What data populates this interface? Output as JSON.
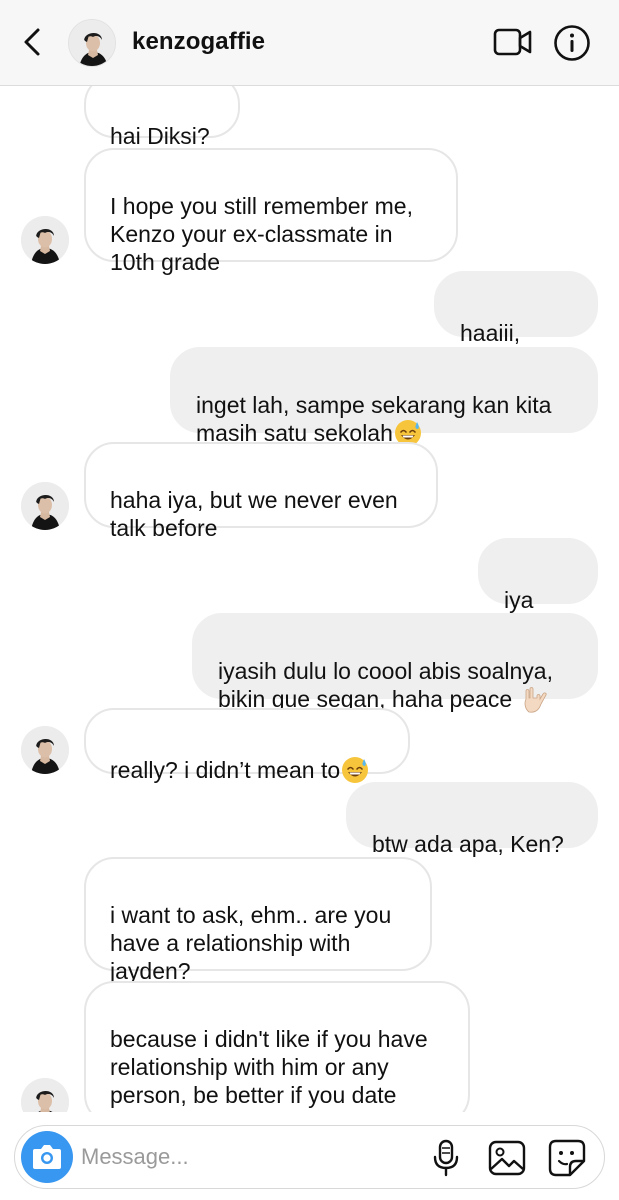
{
  "header": {
    "username": "kenzogaffie",
    "icons": {
      "back": "chevron-left-icon",
      "video": "video-call-icon",
      "info": "info-icon"
    }
  },
  "messages": [
    {
      "sender": "kenzogaffie",
      "direction": "incoming",
      "text": "hai Diksi?"
    },
    {
      "sender": "kenzogaffie",
      "direction": "incoming",
      "text": "I hope you still remember me,\nKenzo your ex-classmate in\n10th grade"
    },
    {
      "sender": "me",
      "direction": "outgoing",
      "text": "haaiii, Ken!"
    },
    {
      "sender": "me",
      "direction": "outgoing",
      "text": "inget lah, sampe sekarang kan kita\nmasih satu sekolah",
      "emoji": "sweat-smile-emoji"
    },
    {
      "sender": "kenzogaffie",
      "direction": "incoming",
      "text": "haha iya, but we never even\ntalk before"
    },
    {
      "sender": "me",
      "direction": "outgoing",
      "text": "iya ya?"
    },
    {
      "sender": "me",
      "direction": "outgoing",
      "text": "iyasih dulu lo coool abis soalnya,\nbikin gue segan, haha peace ",
      "emoji": "love-you-gesture-emoji"
    },
    {
      "sender": "kenzogaffie",
      "direction": "incoming",
      "text": "really? i didn’t mean to",
      "emoji": "sweat-smile-emoji"
    },
    {
      "sender": "me",
      "direction": "outgoing",
      "text": "btw ada apa, Ken?"
    },
    {
      "sender": "kenzogaffie",
      "direction": "incoming",
      "text": "i want to ask, ehm.. are you\nhave a relationship with\njayden?"
    },
    {
      "sender": "kenzogaffie",
      "direction": "incoming",
      "text": "because i didn't like if you have\nrelationship with him or any\nperson, be better if you date\nme instead"
    }
  ],
  "composer": {
    "placeholder": "Message...",
    "value": "",
    "icons": {
      "camera": "camera-icon",
      "mic": "microphone-icon",
      "gallery": "gallery-icon",
      "sticker": "sticker-icon"
    }
  },
  "colors": {
    "header_bg": "#f7f7f7",
    "incoming_border": "#e6e6e6",
    "outgoing_bg": "#efefef",
    "camera_button": "#3897f0",
    "placeholder": "#9a9a9a"
  }
}
